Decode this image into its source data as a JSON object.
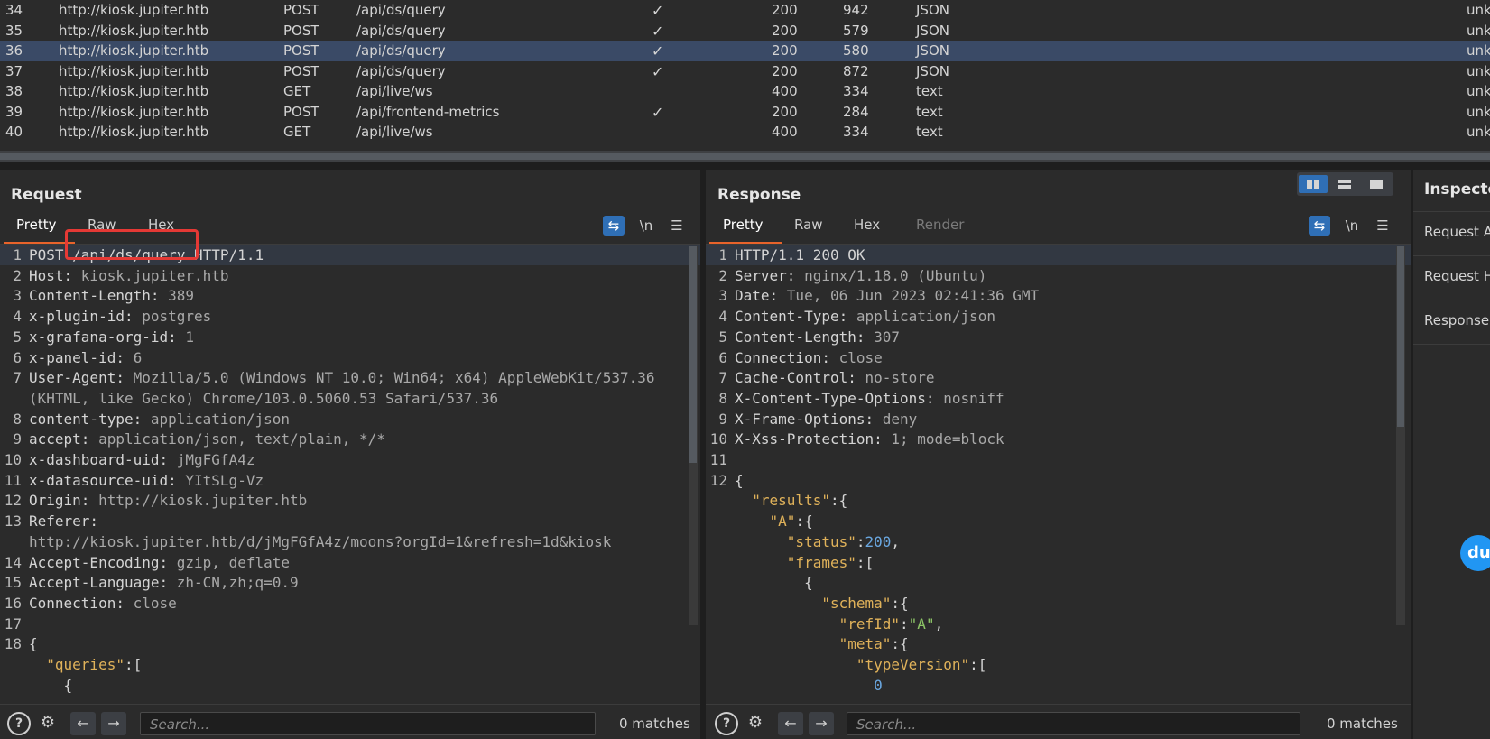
{
  "history": {
    "rows": [
      {
        "num": "34",
        "host": "http://kiosk.jupiter.htb",
        "method": "POST",
        "url": "/api/ds/query",
        "edited": "✓",
        "status": "200",
        "length": "942",
        "mime": "JSON",
        "ext": "unk",
        "selected": false
      },
      {
        "num": "35",
        "host": "http://kiosk.jupiter.htb",
        "method": "POST",
        "url": "/api/ds/query",
        "edited": "✓",
        "status": "200",
        "length": "579",
        "mime": "JSON",
        "ext": "unk",
        "selected": false
      },
      {
        "num": "36",
        "host": "http://kiosk.jupiter.htb",
        "method": "POST",
        "url": "/api/ds/query",
        "edited": "✓",
        "status": "200",
        "length": "580",
        "mime": "JSON",
        "ext": "unk",
        "selected": true
      },
      {
        "num": "37",
        "host": "http://kiosk.jupiter.htb",
        "method": "POST",
        "url": "/api/ds/query",
        "edited": "✓",
        "status": "200",
        "length": "872",
        "mime": "JSON",
        "ext": "unk",
        "selected": false
      },
      {
        "num": "38",
        "host": "http://kiosk.jupiter.htb",
        "method": "GET",
        "url": "/api/live/ws",
        "edited": "",
        "status": "400",
        "length": "334",
        "mime": "text",
        "ext": "unk",
        "selected": false
      },
      {
        "num": "39",
        "host": "http://kiosk.jupiter.htb",
        "method": "POST",
        "url": "/api/frontend-metrics",
        "edited": "✓",
        "status": "200",
        "length": "284",
        "mime": "text",
        "ext": "unk",
        "selected": false
      },
      {
        "num": "40",
        "host": "http://kiosk.jupiter.htb",
        "method": "GET",
        "url": "/api/live/ws",
        "edited": "",
        "status": "400",
        "length": "334",
        "mime": "text",
        "ext": "unk",
        "selected": false
      }
    ]
  },
  "request": {
    "title": "Request",
    "tabs": [
      "Pretty",
      "Raw",
      "Hex"
    ],
    "active_tab": "Pretty",
    "tools": {
      "wrap_icon": "wrap-lines-icon",
      "newline_label": "\\n",
      "menu_icon": "hamburger-icon"
    },
    "lines": [
      {
        "n": "1",
        "k": "POST /api/ds/query HTTP/1.1",
        "v": ""
      },
      {
        "n": "2",
        "k": "Host: ",
        "v": "kiosk.jupiter.htb"
      },
      {
        "n": "3",
        "k": "Content-Length: ",
        "v": "389"
      },
      {
        "n": "4",
        "k": "x-plugin-id: ",
        "v": "postgres"
      },
      {
        "n": "5",
        "k": "x-grafana-org-id: ",
        "v": "1"
      },
      {
        "n": "6",
        "k": "x-panel-id: ",
        "v": "6"
      },
      {
        "n": "7",
        "k": "User-Agent: ",
        "v": "Mozilla/5.0 (Windows NT 10.0; Win64; x64) AppleWebKit/537.36"
      },
      {
        "n": "",
        "k": "",
        "v": "(KHTML, like Gecko) Chrome/103.0.5060.53 Safari/537.36"
      },
      {
        "n": "8",
        "k": "content-type: ",
        "v": "application/json"
      },
      {
        "n": "9",
        "k": "accept: ",
        "v": "application/json, text/plain, */*"
      },
      {
        "n": "10",
        "k": "x-dashboard-uid: ",
        "v": "jMgFGfA4z"
      },
      {
        "n": "11",
        "k": "x-datasource-uid: ",
        "v": "YItSLg-Vz"
      },
      {
        "n": "12",
        "k": "Origin: ",
        "v": "http://kiosk.jupiter.htb"
      },
      {
        "n": "13",
        "k": "Referer: ",
        "v": ""
      },
      {
        "n": "",
        "k": "",
        "v": "http://kiosk.jupiter.htb/d/jMgFGfA4z/moons?orgId=1&refresh=1d&kiosk"
      },
      {
        "n": "14",
        "k": "Accept-Encoding: ",
        "v": "gzip, deflate"
      },
      {
        "n": "15",
        "k": "Accept-Language: ",
        "v": "zh-CN,zh;q=0.9"
      },
      {
        "n": "16",
        "k": "Connection: ",
        "v": "close"
      },
      {
        "n": "17",
        "k": "",
        "v": ""
      },
      {
        "n": "18",
        "k": "{",
        "v": ""
      },
      {
        "n": "",
        "k": "  \"queries\":[",
        "v": ""
      },
      {
        "n": "",
        "k": "    {",
        "v": ""
      }
    ],
    "search": {
      "placeholder": "Search...",
      "matches": "0 matches"
    }
  },
  "response": {
    "title": "Response",
    "tabs": [
      "Pretty",
      "Raw",
      "Hex",
      "Render"
    ],
    "active_tab": "Pretty",
    "lines": [
      {
        "n": "1",
        "k": "HTTP/1.1 200 OK",
        "v": ""
      },
      {
        "n": "2",
        "k": "Server: ",
        "v": "nginx/1.18.0 (Ubuntu)"
      },
      {
        "n": "3",
        "k": "Date: ",
        "v": "Tue, 06 Jun 2023 02:41:36 GMT"
      },
      {
        "n": "4",
        "k": "Content-Type: ",
        "v": "application/json"
      },
      {
        "n": "5",
        "k": "Content-Length: ",
        "v": "307"
      },
      {
        "n": "6",
        "k": "Connection: ",
        "v": "close"
      },
      {
        "n": "7",
        "k": "Cache-Control: ",
        "v": "no-store"
      },
      {
        "n": "8",
        "k": "X-Content-Type-Options: ",
        "v": "nosniff"
      },
      {
        "n": "9",
        "k": "X-Frame-Options: ",
        "v": "deny"
      },
      {
        "n": "10",
        "k": "X-Xss-Protection: ",
        "v": "1; mode=block"
      },
      {
        "n": "11",
        "k": "",
        "v": ""
      },
      {
        "n": "12",
        "k": "{",
        "v": ""
      }
    ],
    "json_lines": [
      {
        "indent": "  ",
        "key": "\"results\"",
        "rest": ":{"
      },
      {
        "indent": "    ",
        "key": "\"A\"",
        "rest": ":{"
      },
      {
        "indent": "      ",
        "key": "\"status\"",
        "num": "200",
        "rest": ","
      },
      {
        "indent": "      ",
        "key": "\"frames\"",
        "rest": ":["
      },
      {
        "indent": "        ",
        "key": "",
        "rest": "{"
      },
      {
        "indent": "          ",
        "key": "\"schema\"",
        "rest": ":{"
      },
      {
        "indent": "            ",
        "key": "\"refId\"",
        "str": "\"A\"",
        "rest": ","
      },
      {
        "indent": "            ",
        "key": "\"meta\"",
        "rest": ":{"
      },
      {
        "indent": "              ",
        "key": "\"typeVersion\"",
        "rest": ":["
      },
      {
        "indent": "                ",
        "key": "",
        "num": "0",
        "rest": ""
      }
    ],
    "search": {
      "placeholder": "Search...",
      "matches": "0 matches"
    }
  },
  "inspector": {
    "title": "Inspector",
    "items": [
      "Request Attributes",
      "Request Headers",
      "Response Headers"
    ]
  },
  "badge": {
    "label": "du"
  },
  "colors": {
    "accent": "#e8632b",
    "selection": "#3a4a66",
    "highlight_box": "#e53935",
    "wrap_button": "#2f6fb6"
  }
}
